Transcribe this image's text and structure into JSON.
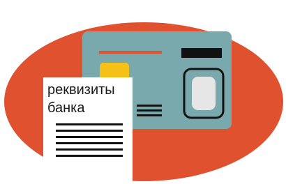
{
  "document": {
    "title_line1": "реквизиты",
    "title_line2": "банка"
  },
  "icons": {
    "card": "bank-card-icon",
    "chip": "chip-icon",
    "document": "document-icon"
  },
  "colors": {
    "background_ellipse": "#e0512f",
    "card": "#7aa9ad",
    "card_stripe": "#e0512f",
    "chip": "#f5c018",
    "ink": "#1a1a1a",
    "paper": "#ffffff",
    "photo_slot": "#e6e6e6"
  }
}
